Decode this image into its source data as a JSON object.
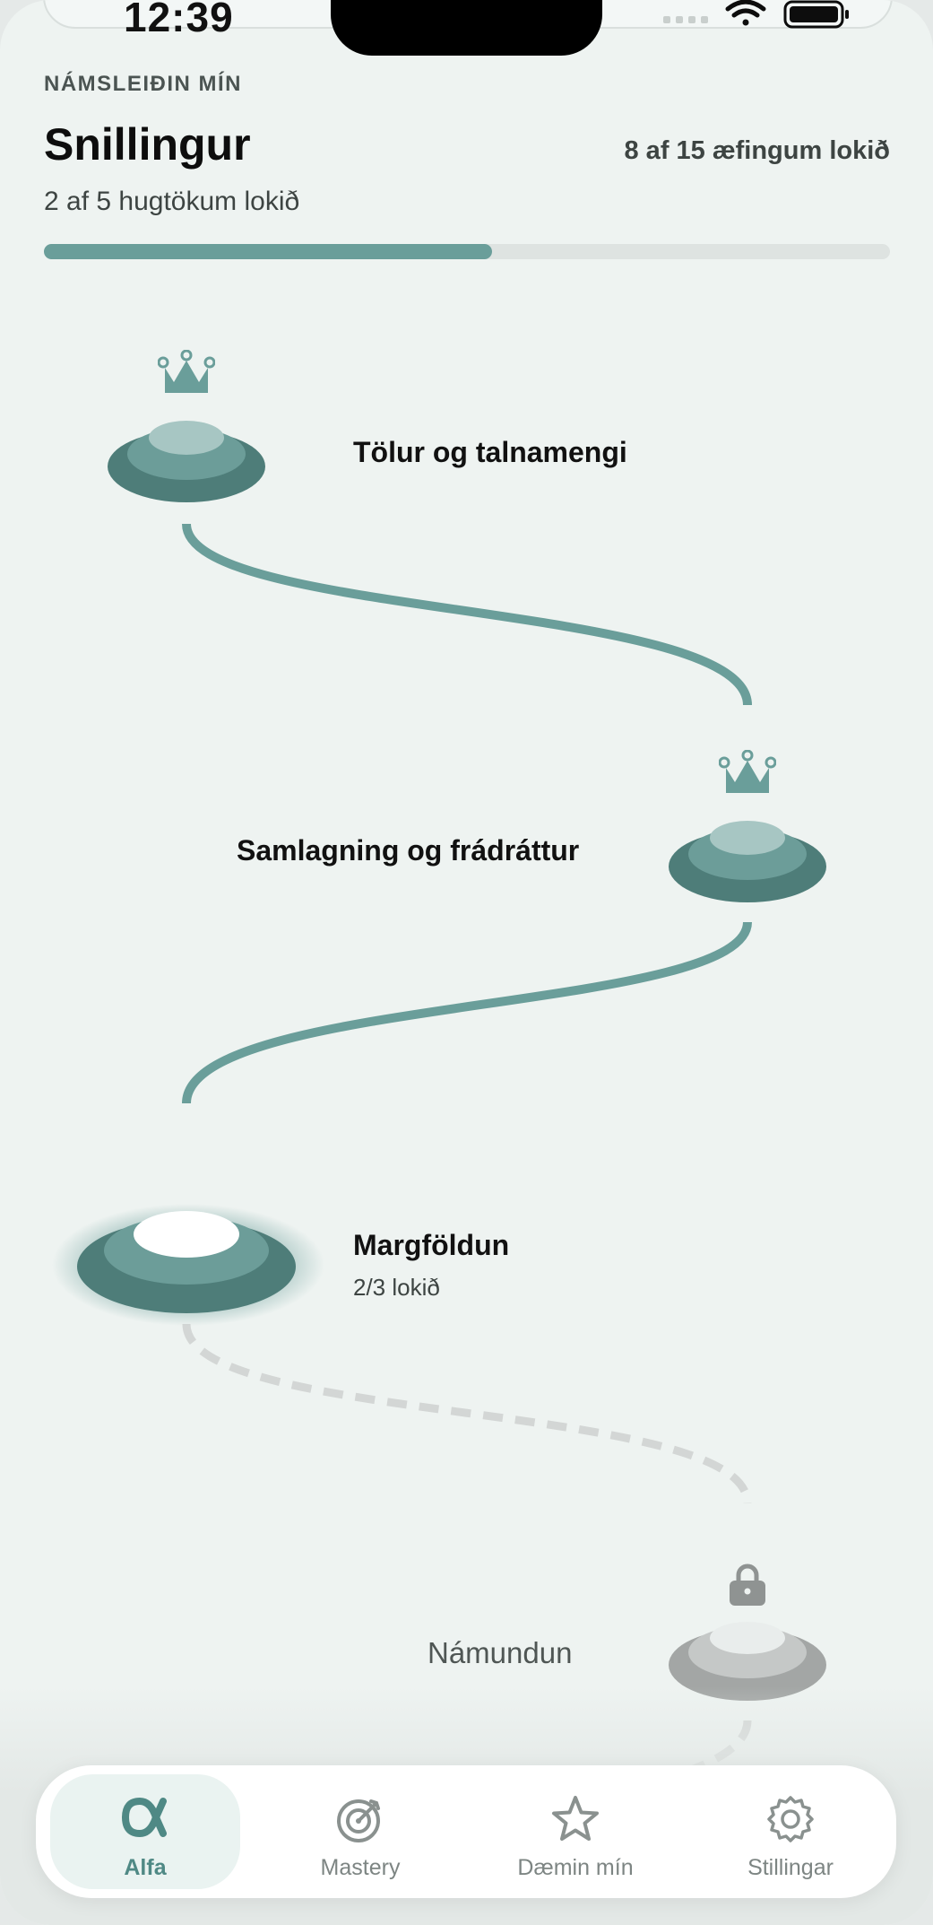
{
  "status_bar": {
    "time": "12:39"
  },
  "header": {
    "overline": "NÁMSLEIÐIN MÍN",
    "title": "Snillingur",
    "exercise_count": "8 af 15 æfingum lokið",
    "concept_count": "2 af 5 hugtökum lokið",
    "progress_fraction": 0.53
  },
  "path_nodes": [
    {
      "label": "Tölur og talnamengi",
      "status": "completed",
      "icon": "crown-icon"
    },
    {
      "label": "Samlagning og frádráttur",
      "status": "completed",
      "icon": "crown-icon"
    },
    {
      "label": "Margföldun",
      "sub": "2/3 lokið",
      "status": "current"
    },
    {
      "label": "Námundun",
      "status": "locked",
      "icon": "lock-icon"
    }
  ],
  "tabs": [
    {
      "label": "Alfa",
      "icon": "alpha-icon",
      "active": true
    },
    {
      "label": "Mastery",
      "icon": "target-icon",
      "active": false
    },
    {
      "label": "Dæmin mín",
      "icon": "star-icon",
      "active": false
    },
    {
      "label": "Stillingar",
      "icon": "gear-icon",
      "active": false
    }
  ],
  "colors": {
    "accent": "#6a9e9a",
    "accent_dark": "#4e7d79",
    "background": "#eef3f1",
    "locked": "#a3a6a5"
  }
}
